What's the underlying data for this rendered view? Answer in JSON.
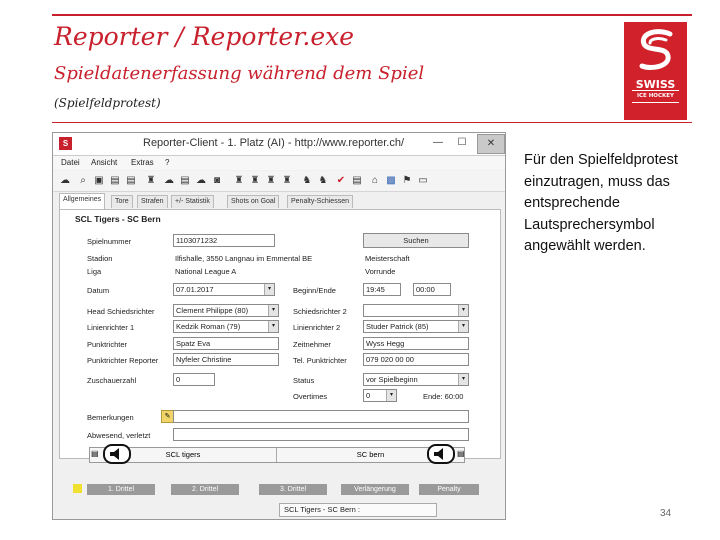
{
  "slide": {
    "title": "Reporter / Reporter.exe",
    "subtitle": "Spieldatenerfassung während dem Spiel",
    "note": "(Spielfeldprotest)",
    "side_text": "Für den Spielfeldprotest einzutragen, muss das entsprechende Lautsprechersymbol angewählt werden.",
    "page_number": "34"
  },
  "logo": {
    "line1": "SWISS",
    "line2": "ICE HOCKEY",
    "color": "#d1222c"
  },
  "window": {
    "title": "Reporter-Client  -  1. Platz (AI)  -  http://www.reporter.ch/",
    "minimize": "—",
    "maximize": "☐",
    "close": "✕"
  },
  "menu": [
    "Datei",
    "Ansicht",
    "Extras",
    "?"
  ],
  "tabs": [
    "Allgemeines",
    "Tore",
    "Strafen",
    "+/- Statistik",
    "Shots on Goal",
    "Penalty-Schiessen"
  ],
  "match": {
    "title": "SCL Tigers - SC Bern",
    "fields": {
      "spielnummer": {
        "label": "Spielnummer",
        "value": "1103071232"
      },
      "search_button": "Suchen",
      "stadion": {
        "label": "Stadion",
        "value": "Ilfishalle, 3550 Langnau im Emmental BE"
      },
      "meisterschaft": "Meisterschaft",
      "liga": {
        "label": "Liga",
        "value": "National League A"
      },
      "vorrunde": "Vorrunde",
      "datum": {
        "label": "Datum",
        "value": "07.01.2017"
      },
      "beginn": {
        "label": "Beginn/Ende",
        "start": "19:45",
        "end": "00:00"
      },
      "head_schiri": {
        "label": "Head Schiedsrichter",
        "value": "Clement Philippe (80)"
      },
      "schiri2": {
        "label": "Schiedsrichter 2",
        "value": ""
      },
      "linienrichter1": {
        "label": "Linienrichter 1",
        "value": "Kedzik Roman (79)"
      },
      "linienrichter2": {
        "label": "Linienrichter 2",
        "value": "Studer Patrick (85)"
      },
      "punktrichter": {
        "label": "Punktrichter",
        "value": "Spatz Eva"
      },
      "zeitnehmer": {
        "label": "Zeitnehmer",
        "value": "Wyss Hegg"
      },
      "punktrichter_reporter": {
        "label": "Punktrichter Reporter",
        "value": "Nyfeler Christine"
      },
      "tel": {
        "label": "Tel. Punktrichter",
        "value": "079 020 00 00"
      },
      "zuschauer": {
        "label": "Zuschauerzahl",
        "value": "0"
      },
      "status": {
        "label": "Status",
        "value": "vor Spielbeginn"
      },
      "overtimes": {
        "label": "Overtimes",
        "value": "0",
        "end_label": "Ende: 60:00"
      },
      "bemerkungen": {
        "label": "Bemerkungen"
      },
      "abwesend": {
        "label": "Abwesend, verletzt"
      }
    },
    "home_team": "SCL tigers",
    "away_team": "SC bern"
  },
  "periods": [
    "1. Drittel",
    "2. Drittel",
    "3. Drittel",
    "Verlängerung",
    "Penalty"
  ],
  "statusbar": "SCL Tigers - SC Bern :"
}
